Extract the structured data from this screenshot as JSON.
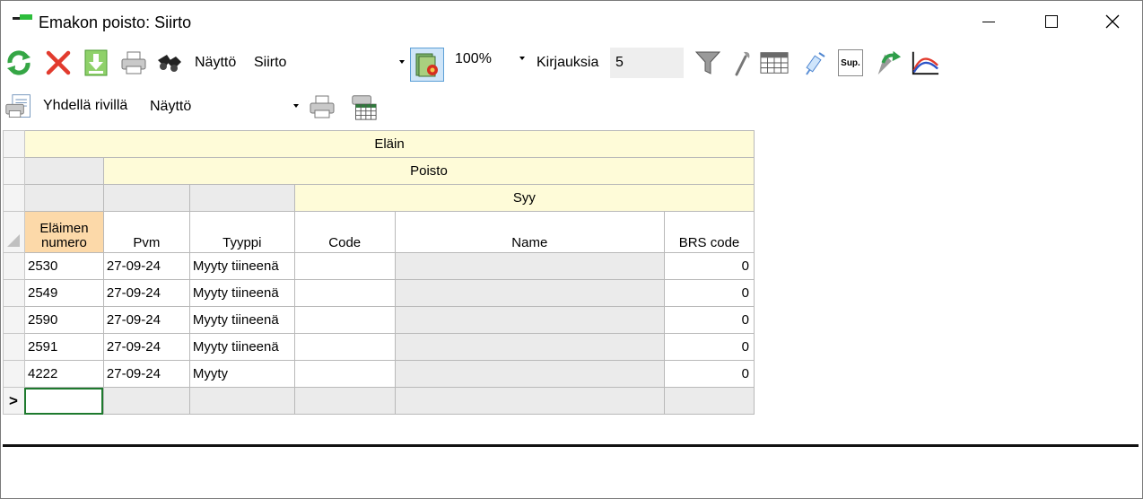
{
  "window": {
    "title": "Emakon poisto: Siirto",
    "controls": [
      "minimize",
      "maximize",
      "close"
    ]
  },
  "toolbar1": {
    "display_label": "Näyttö",
    "display_value": "Siirto",
    "zoom_value": "100%",
    "records_label": "Kirjauksia",
    "records_value": "5",
    "icons": [
      "refresh-icon",
      "delete-icon",
      "download-icon",
      "print-icon",
      "binoculars-icon",
      "report-settings-icon",
      "filter-icon",
      "wrench-icon",
      "calendar-icon",
      "syringe-icon",
      "sup-icon",
      "share-arrow-icon",
      "curve-chart-icon"
    ],
    "sup_text": "Sup."
  },
  "toolbar2": {
    "single_row_label": "Yhdellä rivillä",
    "single_row_value": "Näyttö",
    "icons": [
      "document-print-icon",
      "print-icon",
      "print-grid-icon"
    ]
  },
  "grid": {
    "band1": "Eläin",
    "band2": "Poisto",
    "band3": "Syy",
    "columns": [
      "Eläimen numero",
      "Pvm",
      "Tyyppi",
      "Code",
      "Name",
      "BRS code"
    ],
    "rows": [
      [
        "2530",
        "27-09-24",
        "Myyty tiineenä",
        "",
        "",
        "0"
      ],
      [
        "2549",
        "27-09-24",
        "Myyty tiineenä",
        "",
        "",
        "0"
      ],
      [
        "2590",
        "27-09-24",
        "Myyty tiineenä",
        "",
        "",
        "0"
      ],
      [
        "2591",
        "27-09-24",
        "Myyty tiineenä",
        "",
        "",
        "0"
      ],
      [
        "4222",
        "27-09-24",
        "Myyty",
        "",
        "",
        "0"
      ]
    ],
    "new_row_marker": ">"
  }
}
